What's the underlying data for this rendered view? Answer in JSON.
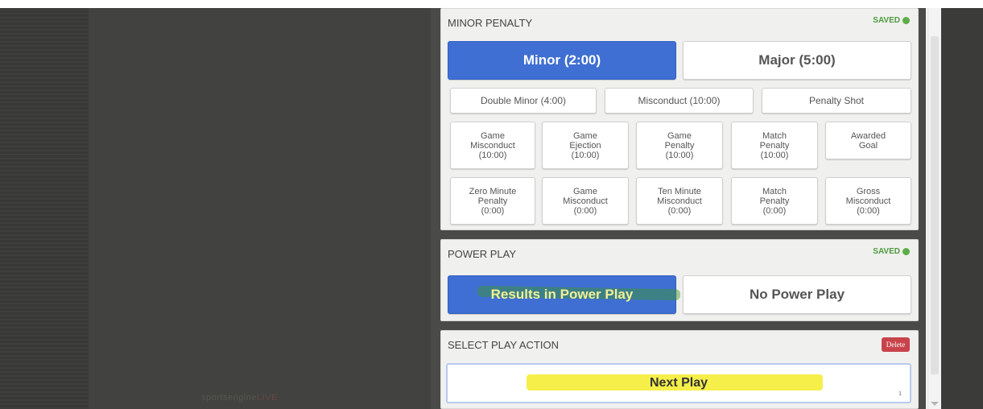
{
  "branding": {
    "name": "sportsengine",
    "suffix": "LIVE"
  },
  "minor_penalty": {
    "title": "MINOR PENALTY",
    "status": "SAVED",
    "primary": [
      {
        "label": "Minor (2:00)",
        "active": true
      },
      {
        "label": "Major (5:00)",
        "active": false
      }
    ],
    "secondary": [
      {
        "label": "Double Minor (4:00)"
      },
      {
        "label": "Misconduct (10:00)"
      },
      {
        "label": "Penalty Shot"
      }
    ],
    "grid_row1": [
      {
        "line1": "Game",
        "line2": "Misconduct",
        "line3": "(10:00)"
      },
      {
        "line1": "Game",
        "line2": "Ejection",
        "line3": "(10:00)"
      },
      {
        "line1": "Game",
        "line2": "Penalty",
        "line3": "(10:00)"
      },
      {
        "line1": "Match",
        "line2": "Penalty",
        "line3": "(10:00)"
      },
      {
        "line1": "Awarded",
        "line2": "Goal",
        "line3": ""
      }
    ],
    "grid_row2": [
      {
        "line1": "Zero Minute",
        "line2": "Penalty",
        "line3": "(0:00)"
      },
      {
        "line1": "Game",
        "line2": "Misconduct",
        "line3": "(0:00)"
      },
      {
        "line1": "Ten Minute",
        "line2": "Misconduct",
        "line3": "(0:00)"
      },
      {
        "line1": "Match",
        "line2": "Penalty",
        "line3": "(0:00)"
      },
      {
        "line1": "Gross",
        "line2": "Misconduct",
        "line3": "(0:00)"
      }
    ]
  },
  "power_play": {
    "title": "POWER PLAY",
    "status": "SAVED",
    "options": [
      {
        "label": "Results in Power Play",
        "active": true
      },
      {
        "label": "No Power Play",
        "active": false
      }
    ]
  },
  "play_action": {
    "title": "SELECT PLAY ACTION",
    "delete_label": "Delete",
    "next_label": "Next Play",
    "corner_mark": "1"
  },
  "colors": {
    "active_blue": "#3f6fd2",
    "saved_green": "#5cad46",
    "delete_red": "#c9434b",
    "highlight_yellow": "#f6ef4a"
  }
}
